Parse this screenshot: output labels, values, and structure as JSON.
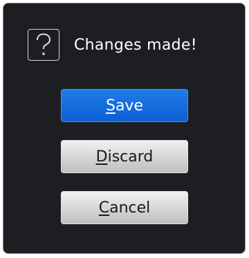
{
  "dialog": {
    "icon": "question-mark-icon",
    "title": "Changes made!",
    "buttons": [
      {
        "mnemonic": "S",
        "rest": "ave"
      },
      {
        "mnemonic": "D",
        "rest": "iscard"
      },
      {
        "mnemonic": "C",
        "rest": "ancel"
      }
    ],
    "colors": {
      "background": "#1c1e21",
      "primary_button": "#0d5fd3",
      "secondary_button": "#d6d6d6"
    }
  }
}
